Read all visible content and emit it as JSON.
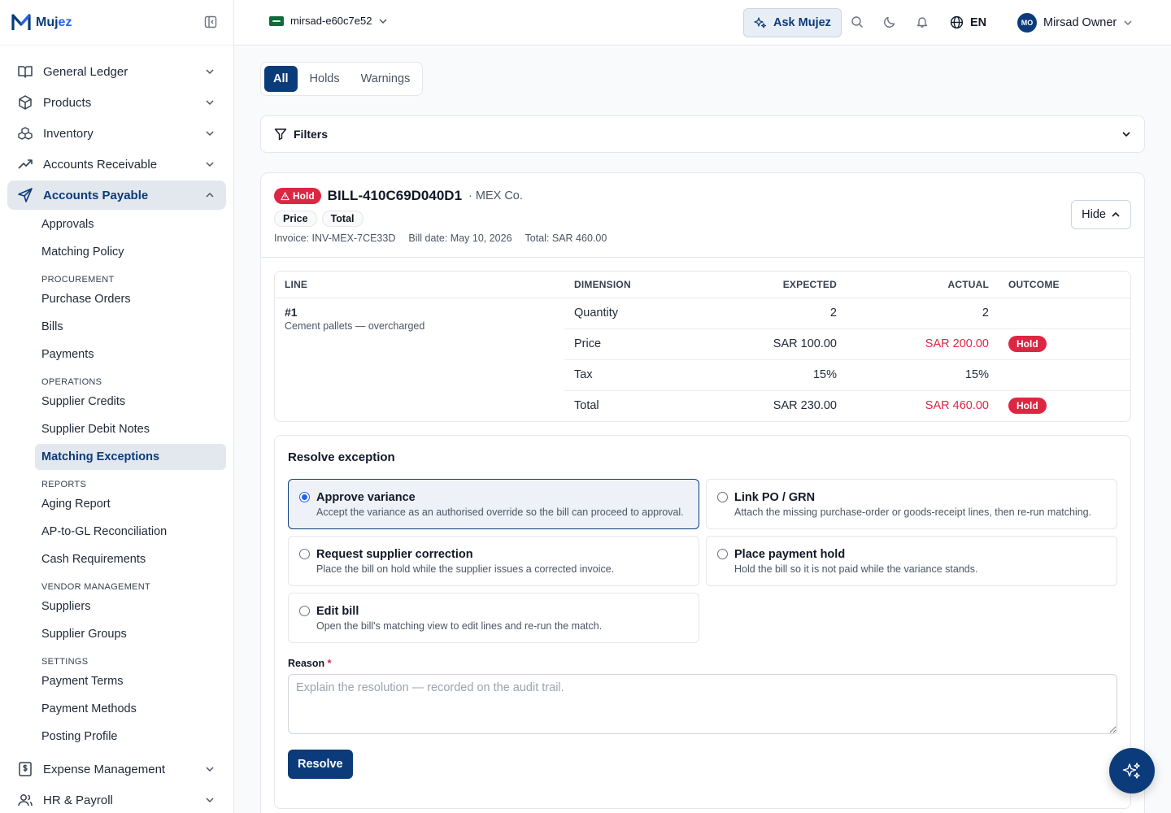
{
  "brand": {
    "name_main": "Muj",
    "name_accent": "ez"
  },
  "sidebar": {
    "items": [
      {
        "label": "General Ledger",
        "icon": "book-open-icon"
      },
      {
        "label": "Products",
        "icon": "package-icon"
      },
      {
        "label": "Inventory",
        "icon": "boxes-icon"
      },
      {
        "label": "Accounts Receivable",
        "icon": "trending-up-icon"
      },
      {
        "label": "Accounts Payable",
        "icon": "send-icon",
        "active": true
      }
    ],
    "ap_sub": {
      "top": [
        "Approvals",
        "Matching Policy"
      ],
      "procurement_heading": "PROCUREMENT",
      "procurement": [
        "Purchase Orders",
        "Bills",
        "Payments"
      ],
      "operations_heading": "OPERATIONS",
      "operations": [
        "Supplier Credits",
        "Supplier Debit Notes",
        "Matching Exceptions"
      ],
      "reports_heading": "REPORTS",
      "reports": [
        "Aging Report",
        "AP-to-GL Reconciliation",
        "Cash Requirements"
      ],
      "vendor_heading": "VENDOR MANAGEMENT",
      "vendor": [
        "Suppliers",
        "Supplier Groups"
      ],
      "settings_heading": "SETTINGS",
      "settings": [
        "Payment Terms",
        "Payment Methods",
        "Posting Profile"
      ]
    },
    "bottom_items": [
      {
        "label": "Expense Management",
        "icon": "receipt-dollar-icon"
      },
      {
        "label": "HR & Payroll",
        "icon": "users-icon"
      }
    ]
  },
  "topbar": {
    "org": "mirsad-e60c7e52",
    "ask": "Ask Mujez",
    "lang": "EN",
    "user_initials": "MO",
    "user_name": "Mirsad Owner"
  },
  "tabs": [
    "All",
    "Holds",
    "Warnings"
  ],
  "filters_label": "Filters",
  "bill": {
    "status": "Hold",
    "id": "BILL-410C69D040D1",
    "vendor": "· MEX Co.",
    "chips": [
      "Price",
      "Total"
    ],
    "invoice": "Invoice: INV-MEX-7CE33D",
    "bill_date": "Bill date: May 10, 2026",
    "total": "Total: SAR 460.00",
    "hide_label": "Hide"
  },
  "lines": {
    "headers": [
      "LINE",
      "DIMENSION",
      "EXPECTED",
      "ACTUAL",
      "OUTCOME"
    ],
    "line_no": "#1",
    "line_desc": "Cement pallets — overcharged",
    "rows": [
      {
        "dimension": "Quantity",
        "expected": "2",
        "actual": "2",
        "outcome": ""
      },
      {
        "dimension": "Price",
        "expected": "SAR 100.00",
        "actual": "SAR 200.00",
        "outcome": "Hold"
      },
      {
        "dimension": "Tax",
        "expected": "15%",
        "actual": "15%",
        "outcome": ""
      },
      {
        "dimension": "Total",
        "expected": "SAR 230.00",
        "actual": "SAR 460.00",
        "outcome": "Hold"
      }
    ]
  },
  "resolve": {
    "title": "Resolve exception",
    "options": [
      {
        "title": "Approve variance",
        "desc": "Accept the variance as an authorised override so the bill can proceed to approval.",
        "selected": true
      },
      {
        "title": "Link PO / GRN",
        "desc": "Attach the missing purchase-order or goods-receipt lines, then re-run matching."
      },
      {
        "title": "Request supplier correction",
        "desc": "Place the bill on hold while the supplier issues a corrected invoice."
      },
      {
        "title": "Place payment hold",
        "desc": "Hold the bill so it is not paid while the variance stands."
      },
      {
        "title": "Edit bill",
        "desc": "Open the bill's matching view to edit lines and re-run the match."
      }
    ],
    "reason_label": "Reason",
    "reason_required": "*",
    "reason_placeholder": "Explain the resolution — recorded on the audit trail.",
    "button": "Resolve"
  },
  "colors": {
    "primary": "#0b3b7a",
    "danger": "#dc2743",
    "accent": "#2563eb"
  }
}
